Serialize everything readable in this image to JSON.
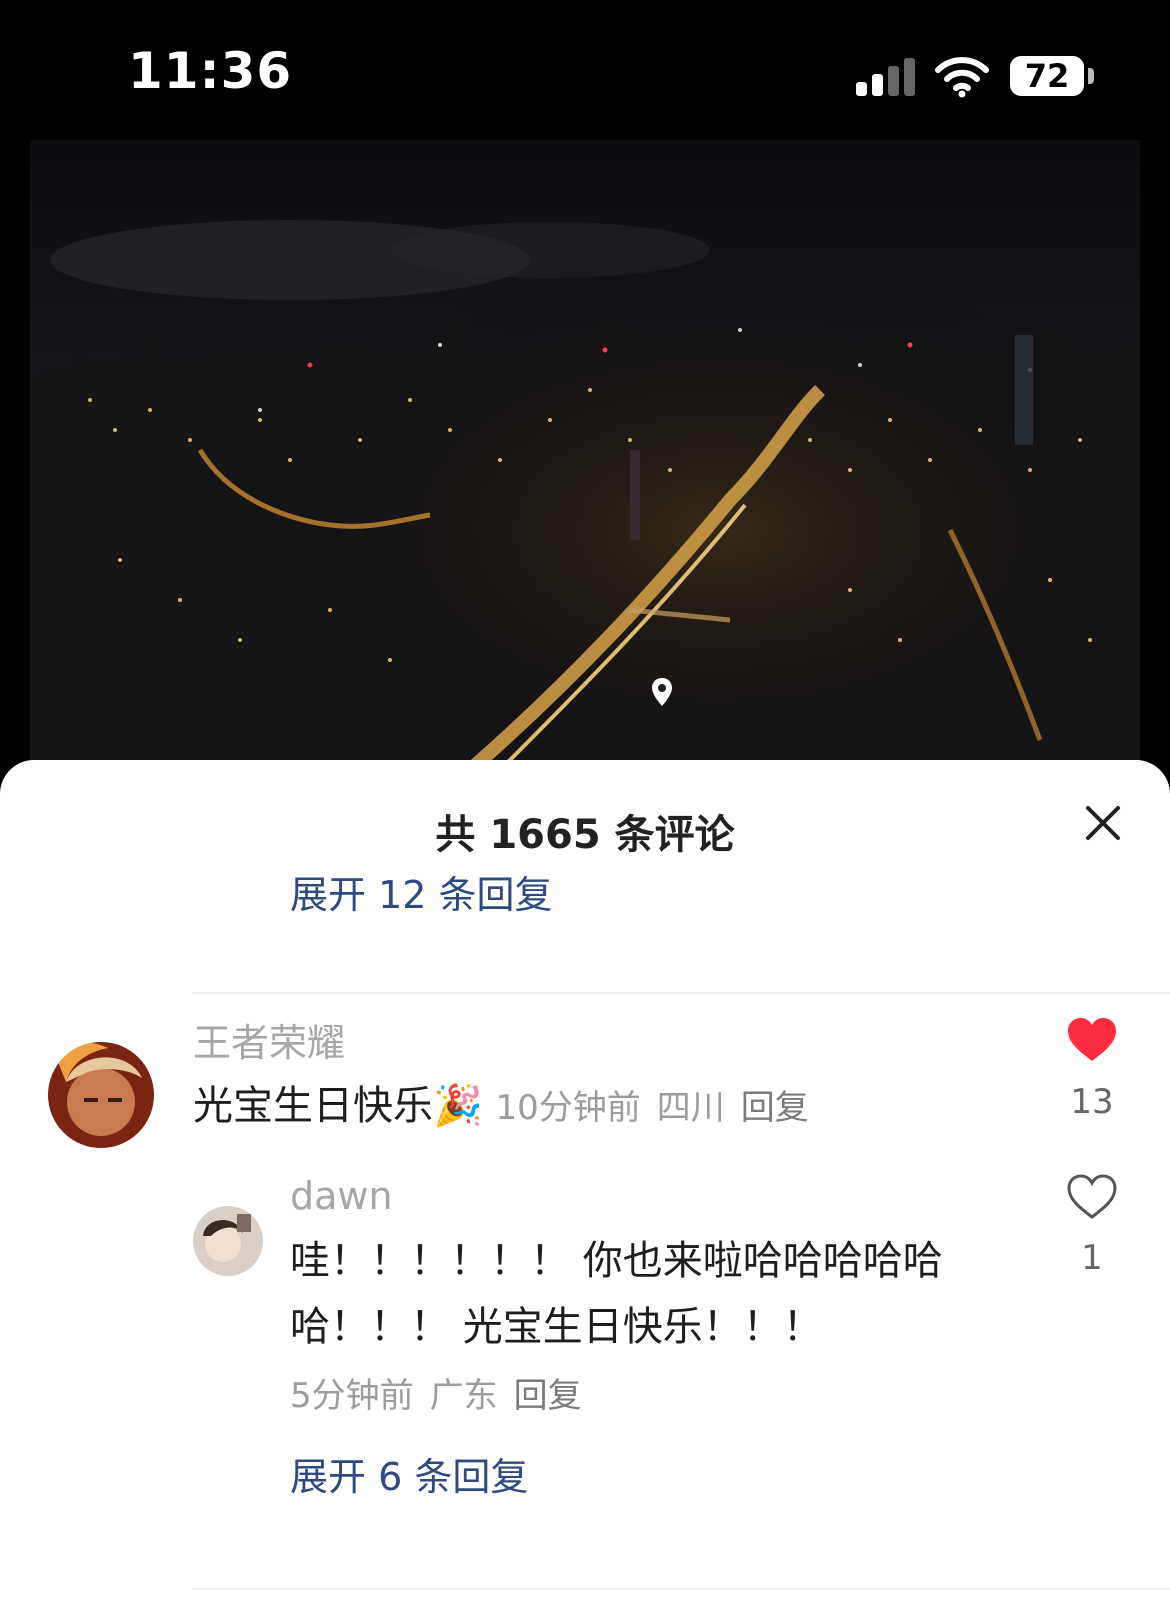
{
  "status_bar": {
    "time": "11:36",
    "battery": "72"
  },
  "sheet": {
    "title": "共 1665 条评论",
    "expand_top": "展开 12 条回复",
    "expand_bottom": "展开 6 条回复"
  },
  "comment": {
    "username": "王者荣耀",
    "text": "光宝生日快乐🎉",
    "time": "10分钟前",
    "location": "四川",
    "reply_label": "回复",
    "likes": "13",
    "liked": true
  },
  "reply": {
    "username": "dawn",
    "line1": "哇！！！！！！ 你也来啦哈哈哈哈哈",
    "line2": "哈！！！ 光宝生日快乐！！！",
    "time": "5分钟前",
    "location": "广东",
    "reply_label": "回复",
    "likes": "1"
  },
  "colors": {
    "link": "#2f4a80",
    "like_active": "#fe2c3f"
  }
}
